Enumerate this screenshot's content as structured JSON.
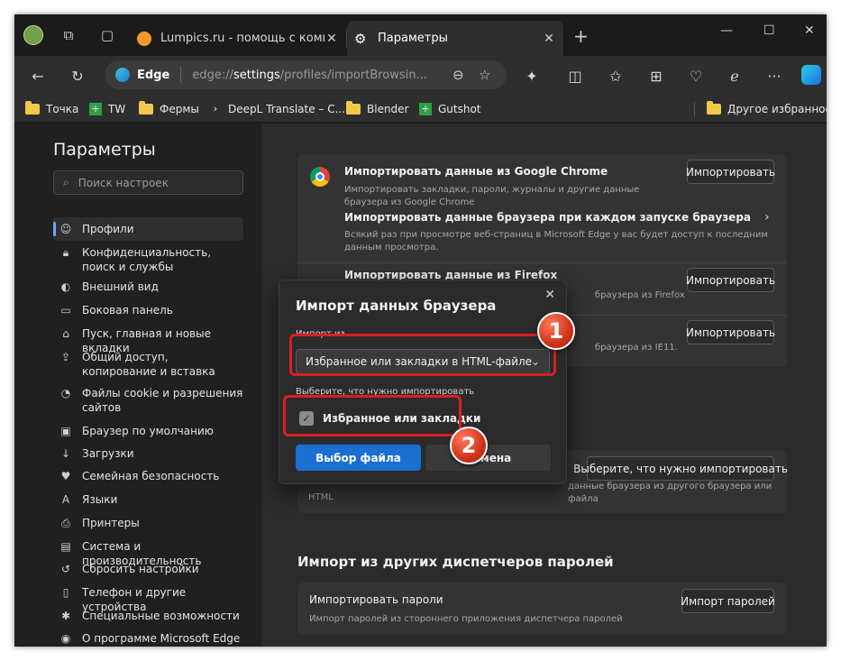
{
  "tabs": [
    {
      "label": "Lumpics.ru - помощь с компьюте",
      "close": "✕"
    },
    {
      "label": "Параметры",
      "close": "✕"
    }
  ],
  "window_controls": {
    "minimize": "—",
    "maximize": "☐",
    "close": "✕"
  },
  "address_bar": {
    "brand": "Edge",
    "url_prefix": "edge://",
    "url_bold": "settings",
    "url_rest": "/profiles/importBrowsin..."
  },
  "favorites_bar": {
    "items": [
      {
        "label": "Точка",
        "icon": "folder"
      },
      {
        "label": "TW",
        "icon": "green-plus"
      },
      {
        "label": "Фермы",
        "icon": "folder"
      },
      {
        "label": "DeepL Translate – C...",
        "icon": "deepl"
      },
      {
        "label": "Blender",
        "icon": "folder"
      },
      {
        "label": "Gutshot",
        "icon": "green-plus"
      }
    ],
    "other": "Другое избранное"
  },
  "sidebar": {
    "title": "Параметры",
    "search_placeholder": "Поиск настроек",
    "items": [
      {
        "label": "Профили",
        "icon": "profile-icon"
      },
      {
        "label": "Конфиденциальность, поиск и службы",
        "icon": "lock-icon"
      },
      {
        "label": "Внешний вид",
        "icon": "palette-icon"
      },
      {
        "label": "Боковая панель",
        "icon": "sidebar-icon"
      },
      {
        "label": "Пуск, главная и новые вкладки",
        "icon": "home-icon"
      },
      {
        "label": "Общий доступ, копирование и вставка",
        "icon": "share-icon"
      },
      {
        "label": "Файлы cookie и разрешения сайтов",
        "icon": "cookie-icon"
      },
      {
        "label": "Браузер по умолчанию",
        "icon": "browser-icon"
      },
      {
        "label": "Загрузки",
        "icon": "download-icon"
      },
      {
        "label": "Семейная безопасность",
        "icon": "family-icon"
      },
      {
        "label": "Языки",
        "icon": "language-icon"
      },
      {
        "label": "Принтеры",
        "icon": "printer-icon"
      },
      {
        "label": "Система и производительность",
        "icon": "system-icon"
      },
      {
        "label": "Сбросить настройки",
        "icon": "reset-icon"
      },
      {
        "label": "Телефон и другие устройства",
        "icon": "phone-icon"
      },
      {
        "label": "Специальные возможности",
        "icon": "accessibility-icon"
      },
      {
        "label": "О программе Microsoft Edge",
        "icon": "edge-icon"
      }
    ]
  },
  "main": {
    "chrome": {
      "title": "Импортировать данные из Google Chrome",
      "desc": "Импортировать закладки, пароли, журналы и другие данные браузера из Google Chrome",
      "button": "Импортировать"
    },
    "each_launch": {
      "title": "Импортировать данные браузера при каждом запуске браузера",
      "desc": "Всякий раз при просмотре веб-страниц в Microsoft Edge у вас будет доступ к последним данным просмотра."
    },
    "firefox": {
      "title": "Импортировать данные из Firefox",
      "desc": "браузера из Firefox",
      "button": "Импортировать"
    },
    "ie": {
      "desc": "браузера из IE11.",
      "button": "Импортировать"
    },
    "other": {
      "desc": "данные браузера из другого браузера или файла",
      "desc2": "HTML",
      "button": "Выберите, что нужно импортировать"
    },
    "passwords_section": {
      "heading": "Импорт из других диспетчеров паролей",
      "title": "Импортировать пароли",
      "desc": "Импорт паролей из стороннего приложения диспетчера паролей",
      "button": "Импорт паролей"
    }
  },
  "dialog": {
    "title": "Импорт данных браузера",
    "import_from_label": "Импорт из",
    "select_value": "Избранное или закладки в HTML-файле",
    "choose_label": "Выберите, что нужно импортировать",
    "checkbox_label": "Избранное или закладки",
    "checkbox_checked": true,
    "primary_button": "Выбор файла",
    "secondary_button": "Отмена"
  },
  "annotations": [
    {
      "number": "1"
    },
    {
      "number": "2"
    }
  ],
  "colors": {
    "accent": "#1a6fd0",
    "highlight": "#d81f26",
    "badge": "#d0341a"
  }
}
